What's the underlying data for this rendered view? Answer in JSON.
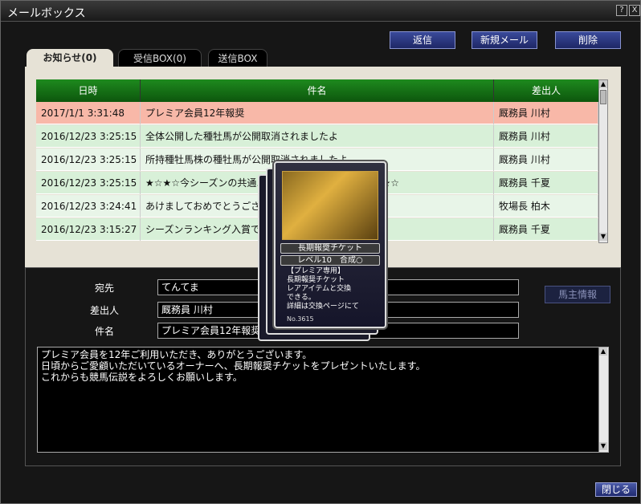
{
  "window": {
    "title": "メールボックス",
    "help_icon": "?",
    "close_icon": "X"
  },
  "toolbar": {
    "reply": "返信",
    "new_mail": "新規メール",
    "delete": "削除"
  },
  "tabs": [
    {
      "label": "お知らせ(0)"
    },
    {
      "label": "受信BOX(0)"
    },
    {
      "label": "送信BOX"
    }
  ],
  "table": {
    "headers": {
      "date": "日時",
      "subject": "件名",
      "sender": "差出人"
    },
    "rows": [
      {
        "date": "2017/1/1 3:31:48",
        "subject": "プレミア会員12年報奨",
        "sender": "厩務員 川村",
        "bg": "#f8b8a8"
      },
      {
        "date": "2016/12/23 3:25:15",
        "subject": "全体公開した種牡馬が公開取消されましたよ",
        "sender": "厩務員 川村",
        "bg": "#d8f0d8"
      },
      {
        "date": "2016/12/23 3:25:15",
        "subject": "所持種牡馬株の種牡馬が公開取消されましたよ",
        "sender": "厩務員 川村",
        "bg": "#e8f5e8"
      },
      {
        "date": "2016/12/23 3:25:15",
        "subject": "★☆★☆今シーズンの共通…………………………☆ ★☆★☆",
        "sender": "厩務員 千夏",
        "bg": "#d8f0d8"
      },
      {
        "date": "2016/12/23 3:24:41",
        "subject": "あけましておめでとうございます",
        "sender": "牧場長 柏木",
        "bg": "#e8f5e8"
      },
      {
        "date": "2016/12/23 3:15:27",
        "subject": "シーズンランキング入賞です",
        "sender": "厩務員 千夏",
        "bg": "#d8f0d8"
      }
    ]
  },
  "detail": {
    "to_label": "宛先",
    "to_value": "てんてま",
    "from_label": "差出人",
    "from_value": "厩務員 川村",
    "subject_label": "件名",
    "subject_value": "プレミア会員12年報奨",
    "owner_info_button": "馬主情報",
    "body": "プレミア会員を12年ご利用いただき、ありがとうございます。\n日頃からご愛顧いただいているオーナーへ、長期報奨チケットをプレゼントいたします。\nこれからも競馬伝説をよろしくお願いします。"
  },
  "card": {
    "name": "長期報奨チケット",
    "level": "レベル10　合成○",
    "description": "【プレミア専用】\n長期報奨チケット\nレアアイテムと交換\nできる。\n詳細は交換ページにて",
    "number": "No.3615"
  },
  "footer": {
    "close": "閉じる"
  }
}
